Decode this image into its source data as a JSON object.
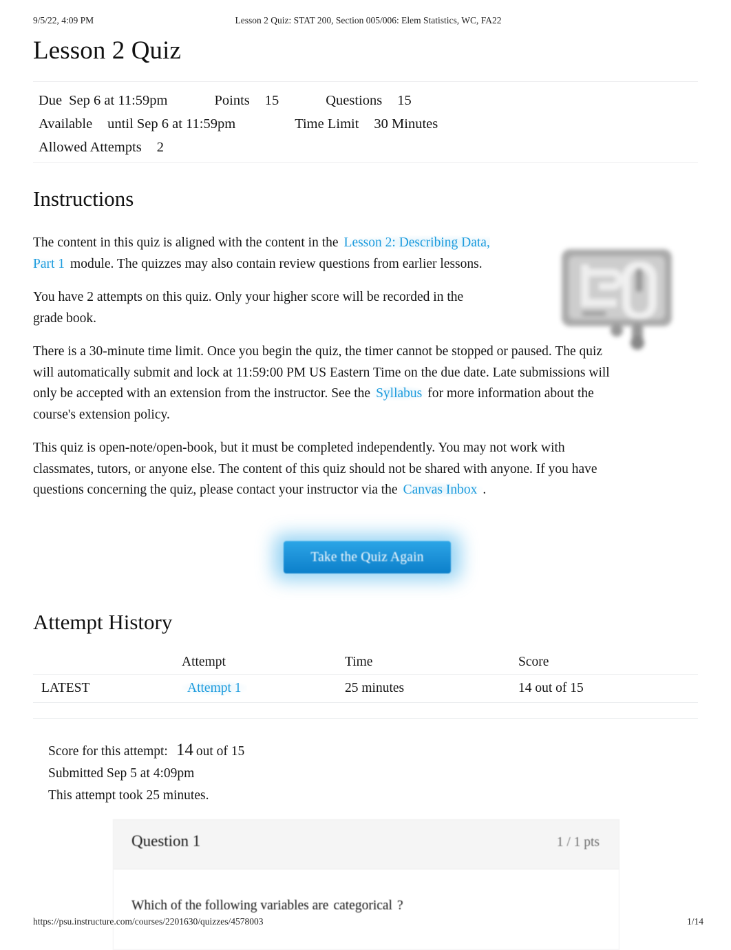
{
  "print_header": {
    "timestamp": "9/5/22, 4:09 PM",
    "document_title": "Lesson 2 Quiz: STAT 200, Section 005/006: Elem Statistics, WC, FA22"
  },
  "page_title": "Lesson 2 Quiz",
  "quiz_details": {
    "due_label": "Due",
    "due_value": "Sep 6 at 11:59pm",
    "points_label": "Points",
    "points_value": "15",
    "questions_label": "Questions",
    "questions_value": "15",
    "available_label": "Available",
    "available_value": "until Sep 6 at 11:59pm",
    "time_limit_label": "Time Limit",
    "time_limit_value": "30 Minutes",
    "allowed_attempts_label": "Allowed Attempts",
    "allowed_attempts_value": "2"
  },
  "instructions": {
    "heading": "Instructions",
    "p1_before_link": "The content in this quiz is aligned with the content in the",
    "p1_link": "Lesson 2: Describing Data, Part 1",
    "p1_after_link": "module. The quizzes may also contain review questions from earlier lessons.",
    "p2": "You have 2 attempts on this quiz. Only your higher score will be recorded in the grade book.",
    "p3_before_link": "There is a 30-minute time limit. Once you begin the quiz, the timer cannot be stopped or paused. The quiz will automatically submit and lock at 11:59:00 PM US Eastern Time on the due date. Late submissions will only be accepted with an extension from the instructor. See the",
    "p3_link": "Syllabus",
    "p3_after_link": "for more information about the course's extension policy.",
    "p4_before_link": "This quiz is open-note/open-book, but it must be completed independently. You may not work with classmates, tutors, or anyone else. The content of this quiz should not be shared with anyone. If you have questions concerning the quiz, please contact your instructor via the",
    "p4_link": "Canvas Inbox",
    "p4_after_link": "."
  },
  "take_quiz_button": "Take the Quiz Again",
  "attempt_history": {
    "heading": "Attempt History",
    "columns": [
      "",
      "Attempt",
      "Time",
      "Score"
    ],
    "rows": [
      {
        "latest_badge": "LATEST",
        "attempt": "Attempt 1",
        "time": "25 minutes",
        "score": "14 out of 15"
      }
    ]
  },
  "attempt_summary": {
    "score_label": "Score for this attempt:",
    "score_value": "14",
    "score_out_of": "out of 15",
    "submitted": "Submitted Sep 5 at 4:09pm",
    "duration": "This attempt took 25 minutes."
  },
  "question": {
    "title": "Question 1",
    "points": "1 / 1 pts",
    "text_before": "Which of the following variables are",
    "emphasis": "categorical",
    "text_after": "?"
  },
  "print_footer": {
    "url": "https://psu.instructure.com/courses/2201630/quizzes/4578003",
    "page_number": "1/14"
  },
  "colors": {
    "link": "#1c9bdd",
    "button": "#1e93d9",
    "text": "#161616",
    "rule": "#ededef",
    "card_header": "#f5f5f5"
  },
  "icons": {
    "book": "open-book-icon"
  }
}
